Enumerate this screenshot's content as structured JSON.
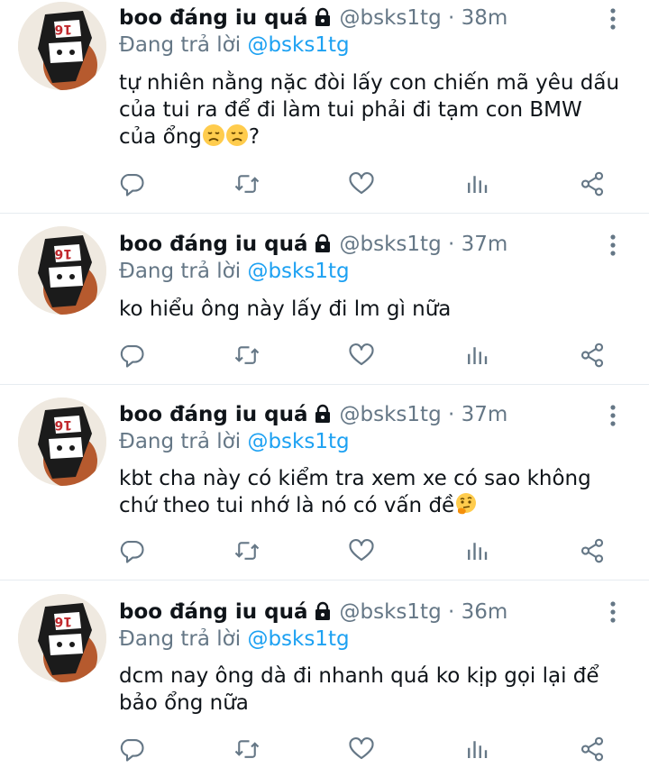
{
  "tweets": [
    {
      "name": "boo đáng iu quá",
      "handle": "@bsks1tg",
      "sep": "·",
      "time": "38m",
      "replying_prefix": "Đang trả lời",
      "replying_to": "@bsks1tg",
      "text": "tự nhiên nằng nặc đòi lấy con chiến mã yêu dấu\ncủa tui ra để đi làm tui phải đi tạm con BMW\ncủa ổng",
      "text_suffix": "?",
      "emojis": [
        "disappointed-face",
        "disappointed-face"
      ]
    },
    {
      "name": "boo đáng iu quá",
      "handle": "@bsks1tg",
      "sep": "·",
      "time": "37m",
      "replying_prefix": "Đang trả lời",
      "replying_to": "@bsks1tg",
      "text": "ko hiểu ông này lấy đi lm gì nữa",
      "text_suffix": "",
      "emojis": []
    },
    {
      "name": "boo đáng iu quá",
      "handle": "@bsks1tg",
      "sep": "·",
      "time": "37m",
      "replying_prefix": "Đang trả lời",
      "replying_to": "@bsks1tg",
      "text": "kbt cha này có kiểm tra xem xe có sao không\nchứ theo tui nhớ là nó có vấn đề",
      "text_suffix": "",
      "emojis": [
        "thinking-face"
      ]
    },
    {
      "name": "boo đáng iu quá",
      "handle": "@bsks1tg",
      "sep": "·",
      "time": "36m",
      "replying_prefix": "Đang trả lời",
      "replying_to": "@bsks1tg",
      "text": "dcm nay ông dà đi nhanh quá ko kịp gọi lại để\nbảo ổng nữa",
      "text_suffix": "",
      "emojis": []
    }
  ],
  "colors": {
    "text": "#0f1419",
    "muted": "#657786",
    "link": "#1da1f2",
    "divider": "#e6ecf0"
  },
  "icons": [
    "avatar-image",
    "lock-icon",
    "more-options-icon",
    "reply-icon",
    "retweet-icon",
    "like-icon",
    "analytics-icon",
    "share-icon"
  ]
}
